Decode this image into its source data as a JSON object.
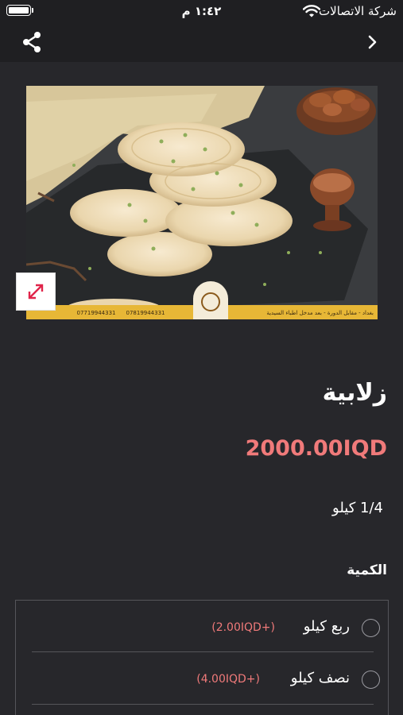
{
  "status_bar": {
    "time": "١:٤٢ م",
    "carrier": "شركة الاتصالات",
    "battery_icon": "battery-icon",
    "wifi_icon": "wifi-icon"
  },
  "nav": {
    "share_icon": "share-icon",
    "back_icon": "chevron-right-icon"
  },
  "product": {
    "image_banner_right": "بغداد - مقابل الدورة - بعد مدخل اطباء السيدية",
    "image_phone_1": "07819944331",
    "image_phone_2": "07719944331",
    "title": "زلابية",
    "price": "2000.00IQD",
    "unit": "1/4 كيلو"
  },
  "quantity": {
    "label": "الكمية",
    "options": [
      {
        "label": "ربع كيلو",
        "extra": "(+2.00IQD)"
      },
      {
        "label": "نصف كيلو",
        "extra": "(+4.00IQD)"
      }
    ]
  },
  "colors": {
    "accent": "#f07a7a",
    "background": "#27272b",
    "bar": "#1f1f22",
    "expand_icon": "#e0244a"
  }
}
